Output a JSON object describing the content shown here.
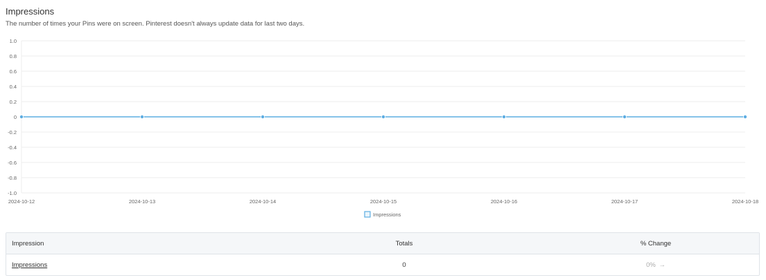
{
  "header": {
    "title": "Impressions",
    "subtitle": "The number of times your Pins were on screen. Pinterest doesn't always update data for last two days."
  },
  "chart_data": {
    "type": "line",
    "title": "",
    "xlabel": "",
    "ylabel": "",
    "x": [
      "2024-10-12",
      "2024-10-13",
      "2024-10-14",
      "2024-10-15",
      "2024-10-16",
      "2024-10-17",
      "2024-10-18"
    ],
    "series": [
      {
        "name": "Impressions",
        "values": [
          0,
          0,
          0,
          0,
          0,
          0,
          0
        ],
        "color": "#5dade2"
      }
    ],
    "y_ticks": [
      "1.0",
      "0.8",
      "0.6",
      "0.4",
      "0.2",
      "0",
      "-0.2",
      "-0.4",
      "-0.6",
      "-0.8",
      "-1.0"
    ],
    "ylim": [
      -1.0,
      1.0
    ],
    "grid": true,
    "legend": "bottom-center"
  },
  "table": {
    "headers": [
      "Impression",
      "Totals",
      "% Change"
    ],
    "rows": [
      {
        "name": "Impressions",
        "total": "0",
        "change": "0%",
        "change_icon": "arrow-right-icon"
      }
    ]
  },
  "colors": {
    "series": "#5dade2",
    "grid": "#ececec",
    "table_header_bg": "#f5f7f9",
    "border": "#dfe3e8"
  }
}
